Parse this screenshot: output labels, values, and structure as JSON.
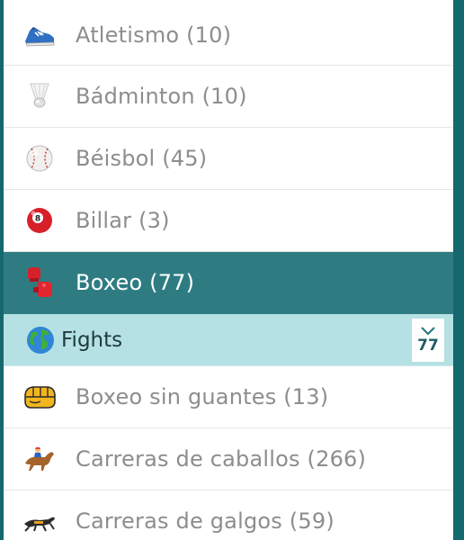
{
  "sports": [
    {
      "label": "Atletismo (10)",
      "icon": "running-shoe-icon"
    },
    {
      "label": "Bádminton (10)",
      "icon": "shuttlecock-icon"
    },
    {
      "label": "Béisbol (45)",
      "icon": "baseball-icon"
    },
    {
      "label": "Billar (3)",
      "icon": "billiard-ball-icon"
    },
    {
      "label": "Boxeo (77)",
      "icon": "boxing-glove-icon",
      "active": true
    }
  ],
  "sub_category": {
    "label": "Fights",
    "icon": "globe-icon",
    "count": "77"
  },
  "sports_after": [
    {
      "label": "Boxeo sin guantes (13)",
      "icon": "bare-knuckle-icon"
    },
    {
      "label": "Carreras de caballos (266)",
      "icon": "horse-racing-icon"
    },
    {
      "label": "Carreras de galgos (59)",
      "icon": "greyhound-icon"
    }
  ],
  "colors": {
    "active_row": "#2e7c82",
    "sub_row": "#b5e1e4",
    "frame": "#15686d"
  }
}
